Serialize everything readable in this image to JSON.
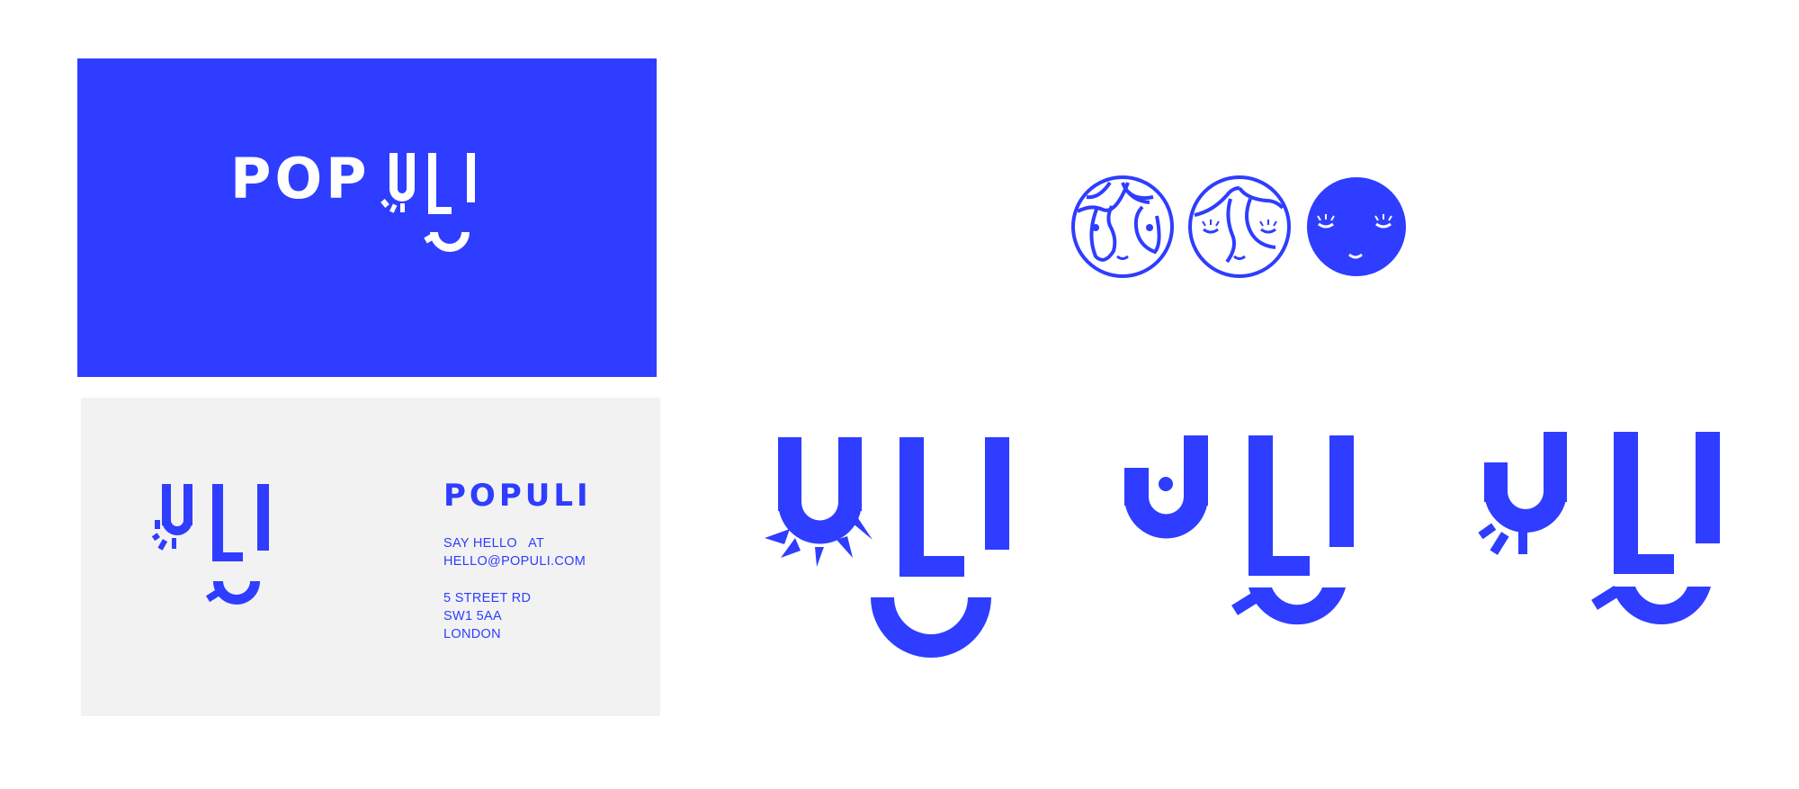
{
  "card_front": {
    "wordmark": "POP",
    "logo_name": "populi-logo-wordmark"
  },
  "card_back": {
    "name": "POPULI",
    "contact_heading": "SAY HELLO   AT",
    "email": "HELLO@POPULI.COM",
    "address_line1": "5 STREET RD",
    "address_line2": "SW1 5AA",
    "address_line3": "LONDON"
  },
  "logo_lettering": "ULI",
  "face_icons": [
    "face-open-eyes-icon",
    "face-lashes-icon",
    "face-solid-wink-icon"
  ],
  "logo_variants": [
    "uli-sun-variant",
    "uli-dot-variant",
    "uli-splash-variant"
  ],
  "colors": {
    "brand_blue": "#2e3dff",
    "card_back_grey": "#f2f2f2",
    "white": "#ffffff"
  }
}
